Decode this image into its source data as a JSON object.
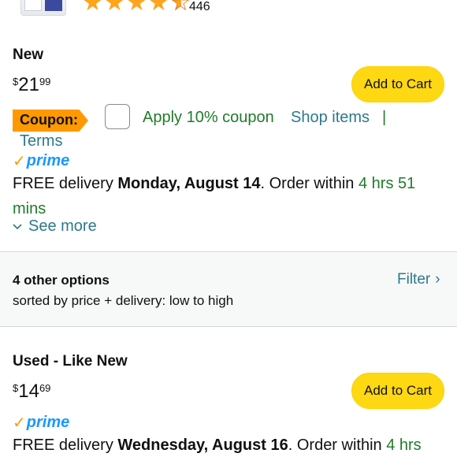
{
  "rating": {
    "stars": 4.5,
    "count": "446"
  },
  "new_offer": {
    "condition": "New",
    "price_symbol": "$",
    "price_whole": "21",
    "price_fraction": "99",
    "add_to_cart": "Add to Cart",
    "coupon_label": "Coupon:",
    "coupon_text": "Apply 10% coupon",
    "shop_items": "Shop items",
    "separator": "|",
    "terms": "Terms",
    "prime_check": "✓",
    "prime_label": "prime",
    "delivery_prefix": "FREE delivery ",
    "delivery_date": "Monday, August 14",
    "delivery_mid": ". Order within ",
    "delivery_time": "4 hrs 51 mins",
    "see_more": "See more"
  },
  "other_options": {
    "title": "4 other options",
    "subtitle": "sorted by price + delivery: low to high",
    "filter": "Filter",
    "filter_chevron": "›"
  },
  "used_offer": {
    "condition": "Used - Like New",
    "price_symbol": "$",
    "price_whole": "14",
    "price_fraction": "69",
    "add_to_cart": "Add to Cart",
    "prime_check": "✓",
    "prime_label": "prime",
    "delivery_prefix": "FREE delivery ",
    "delivery_date": "Wednesday, August 16",
    "delivery_mid": ". Order within ",
    "delivery_time": "4 hrs"
  },
  "colors": {
    "accent_yellow": "#ffd814",
    "coupon_orange": "#ff9900",
    "link_teal": "#2b7a8c",
    "deal_green": "#207b2a",
    "prime_blue": "#1a98ff"
  }
}
